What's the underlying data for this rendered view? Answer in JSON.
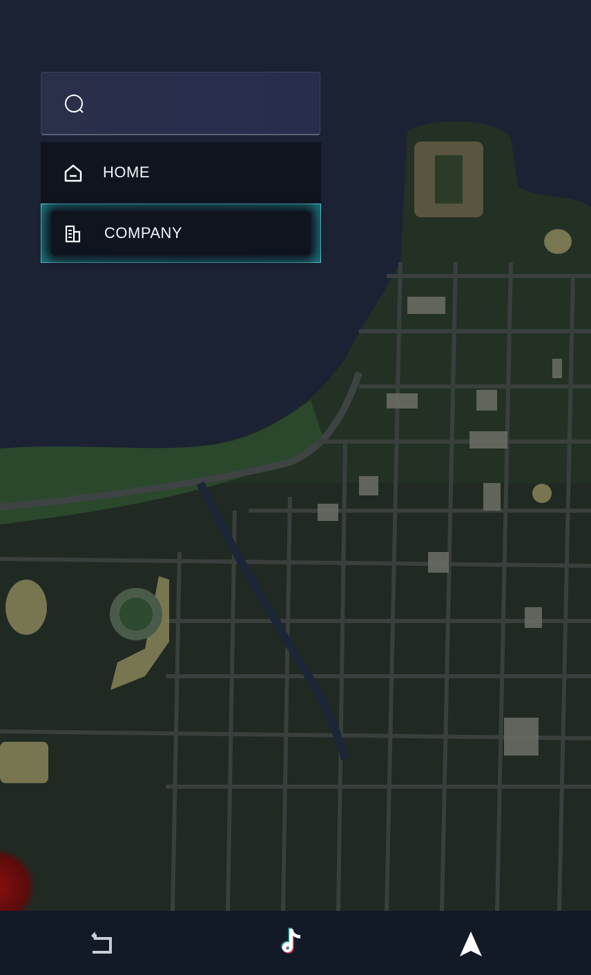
{
  "search": {
    "placeholder": ""
  },
  "menu": {
    "items": [
      {
        "label": "HOME",
        "icon": "home-icon",
        "active": false
      },
      {
        "label": "COMPANY",
        "icon": "company-building-icon",
        "active": true
      }
    ]
  },
  "bottom_bar": {
    "buttons": [
      {
        "icon": "back-return-icon"
      },
      {
        "icon": "tiktok-icon"
      },
      {
        "icon": "navigation-arrow-icon"
      }
    ]
  },
  "colors": {
    "accent": "#53c8d1",
    "menu_bg": "#0f141f",
    "search_bg": "#2a2f4a",
    "bar_bg": "#131a27"
  }
}
